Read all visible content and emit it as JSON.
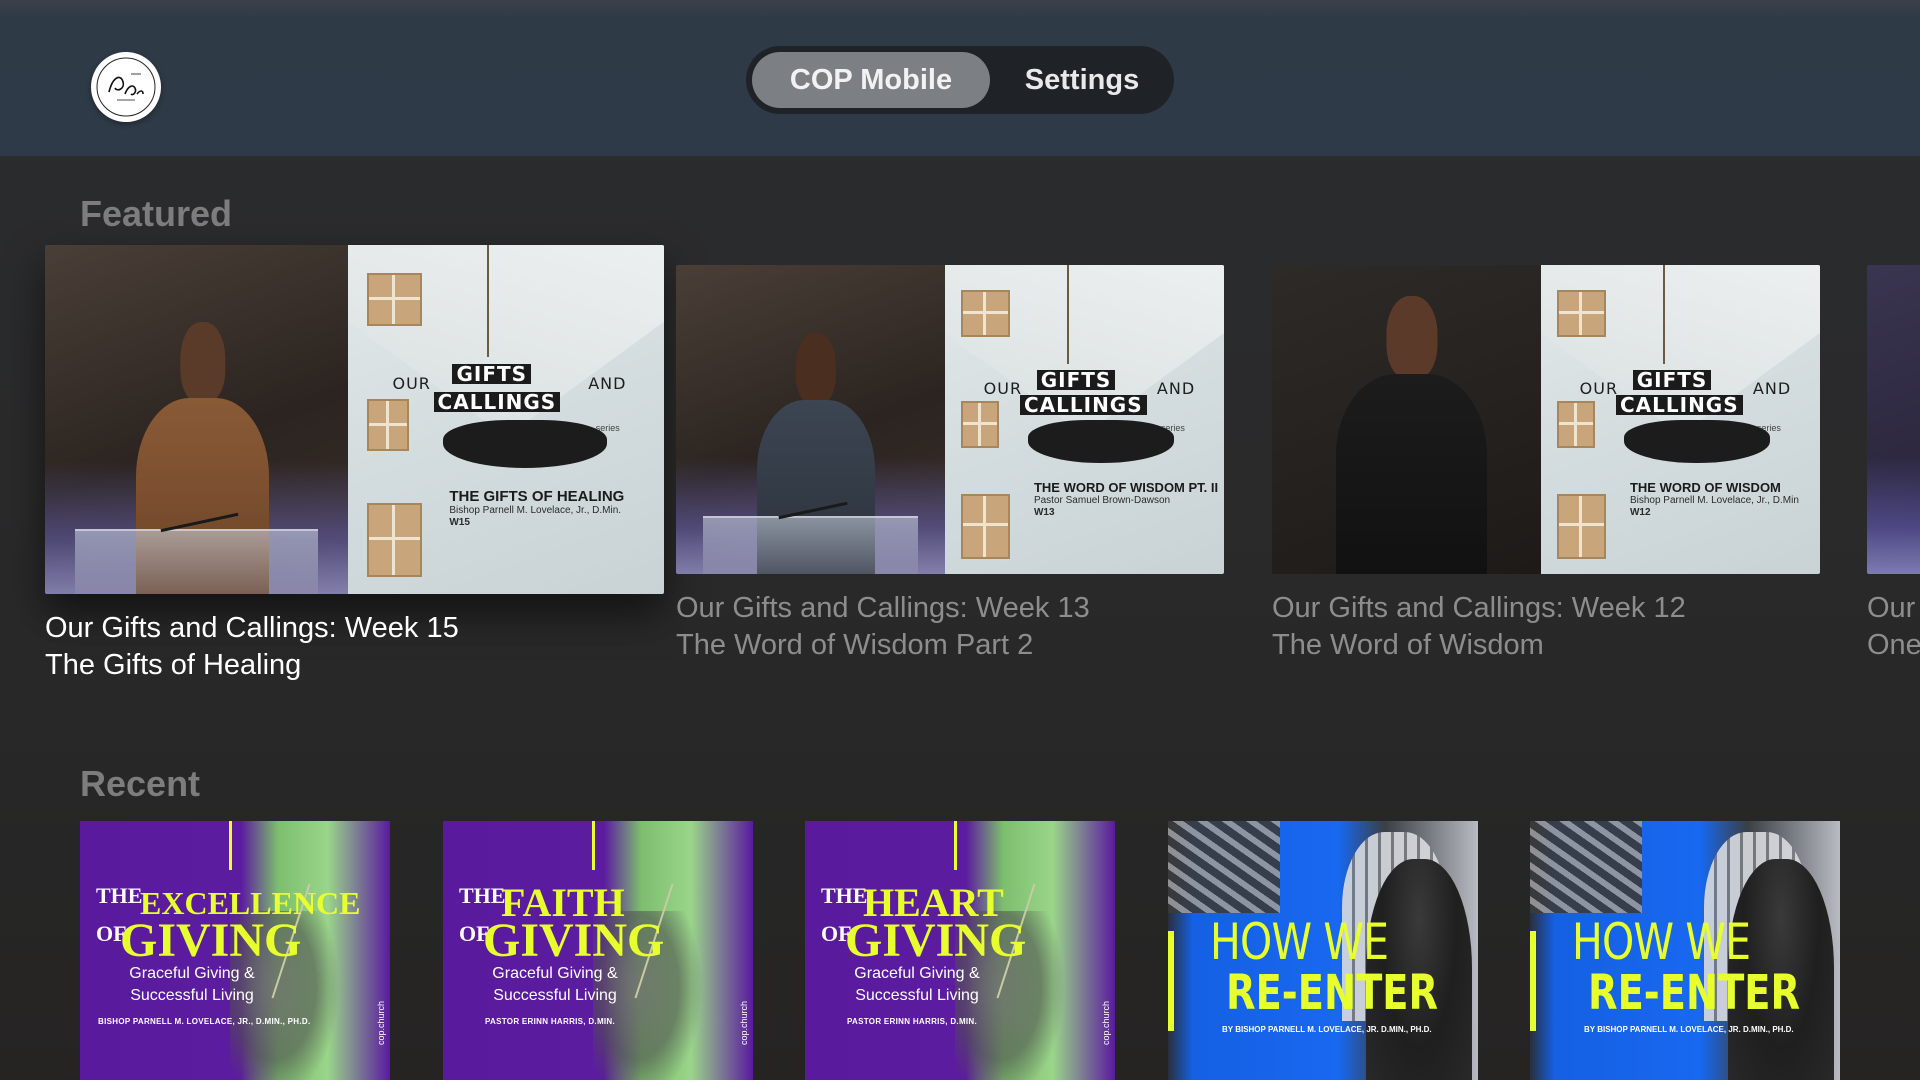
{
  "header": {
    "logo_text": "Center of Praise",
    "tabs": [
      {
        "label": "COP Mobile",
        "active": true
      },
      {
        "label": "Settings",
        "active": false
      }
    ]
  },
  "featured": {
    "title": "Featured",
    "items": [
      {
        "title": "Our Gifts and Callings:  Week 15",
        "subtitle": "The Gifts of Healing",
        "art_our": "OUR",
        "art_gifts": "GIFTS",
        "art_and": "AND",
        "art_callings": "CALLINGS",
        "art_series": "series",
        "art_episode": "THE GIFTS OF HEALING",
        "art_speaker": "Bishop Parnell M. Lovelace, Jr., D.Min.",
        "art_code": "W15",
        "focused": true
      },
      {
        "title": "Our Gifts and Callings:  Week 13",
        "subtitle": "The Word of Wisdom Part 2",
        "art_our": "OUR",
        "art_gifts": "GIFTS",
        "art_and": "AND",
        "art_callings": "CALLINGS",
        "art_series": "series",
        "art_episode": "THE WORD OF WISDOM PT. II",
        "art_speaker": "Pastor Samuel Brown-Dawson",
        "art_code": "W13",
        "focused": false
      },
      {
        "title": "Our Gifts and Callings:  Week 12",
        "subtitle": "The Word of Wisdom",
        "art_our": "OUR",
        "art_gifts": "GIFTS",
        "art_and": "AND",
        "art_callings": "CALLINGS",
        "art_series": "series",
        "art_episode": "THE WORD OF WISDOM",
        "art_speaker": "Bishop Parnell M. Lovelace, Jr., D.Min",
        "art_code": "W12",
        "focused": false
      },
      {
        "title": "Our",
        "subtitle": "One",
        "focused": false
      }
    ]
  },
  "recent": {
    "title": "Recent",
    "items": [
      {
        "pre": "THE",
        "word": "EXCELLENCE",
        "of": "OF",
        "giving": "GIVING",
        "subtitle1": "Graceful Giving &",
        "subtitle2": "Successful Living",
        "author": "BISHOP PARNELL M. LOVELACE, JR., D.MIN., PH.D.",
        "site": "cop.church"
      },
      {
        "pre": "THE",
        "word": "FAITH",
        "of": "OF",
        "giving": "GIVING",
        "subtitle1": "Graceful Giving &",
        "subtitle2": "Successful Living",
        "author": "PASTOR ERINN HARRIS, D.MIN.",
        "site": "cop.church"
      },
      {
        "pre": "THE",
        "word": "HEART",
        "of": "OF",
        "giving": "GIVING",
        "subtitle1": "Graceful Giving &",
        "subtitle2": "Successful Living",
        "author": "PASTOR ERINN HARRIS, D.MIN.",
        "site": "cop.church"
      },
      {
        "line1": "HOW WE",
        "line2": "RE-ENTER",
        "author": "BY BISHOP PARNELL M. LOVELACE, JR. D.MIN., PH.D."
      },
      {
        "line1": "HOW WE",
        "line2": "RE-ENTER",
        "author": "BY BISHOP PARNELL M. LOVELACE, JR. D.MIN., PH.D."
      }
    ]
  }
}
